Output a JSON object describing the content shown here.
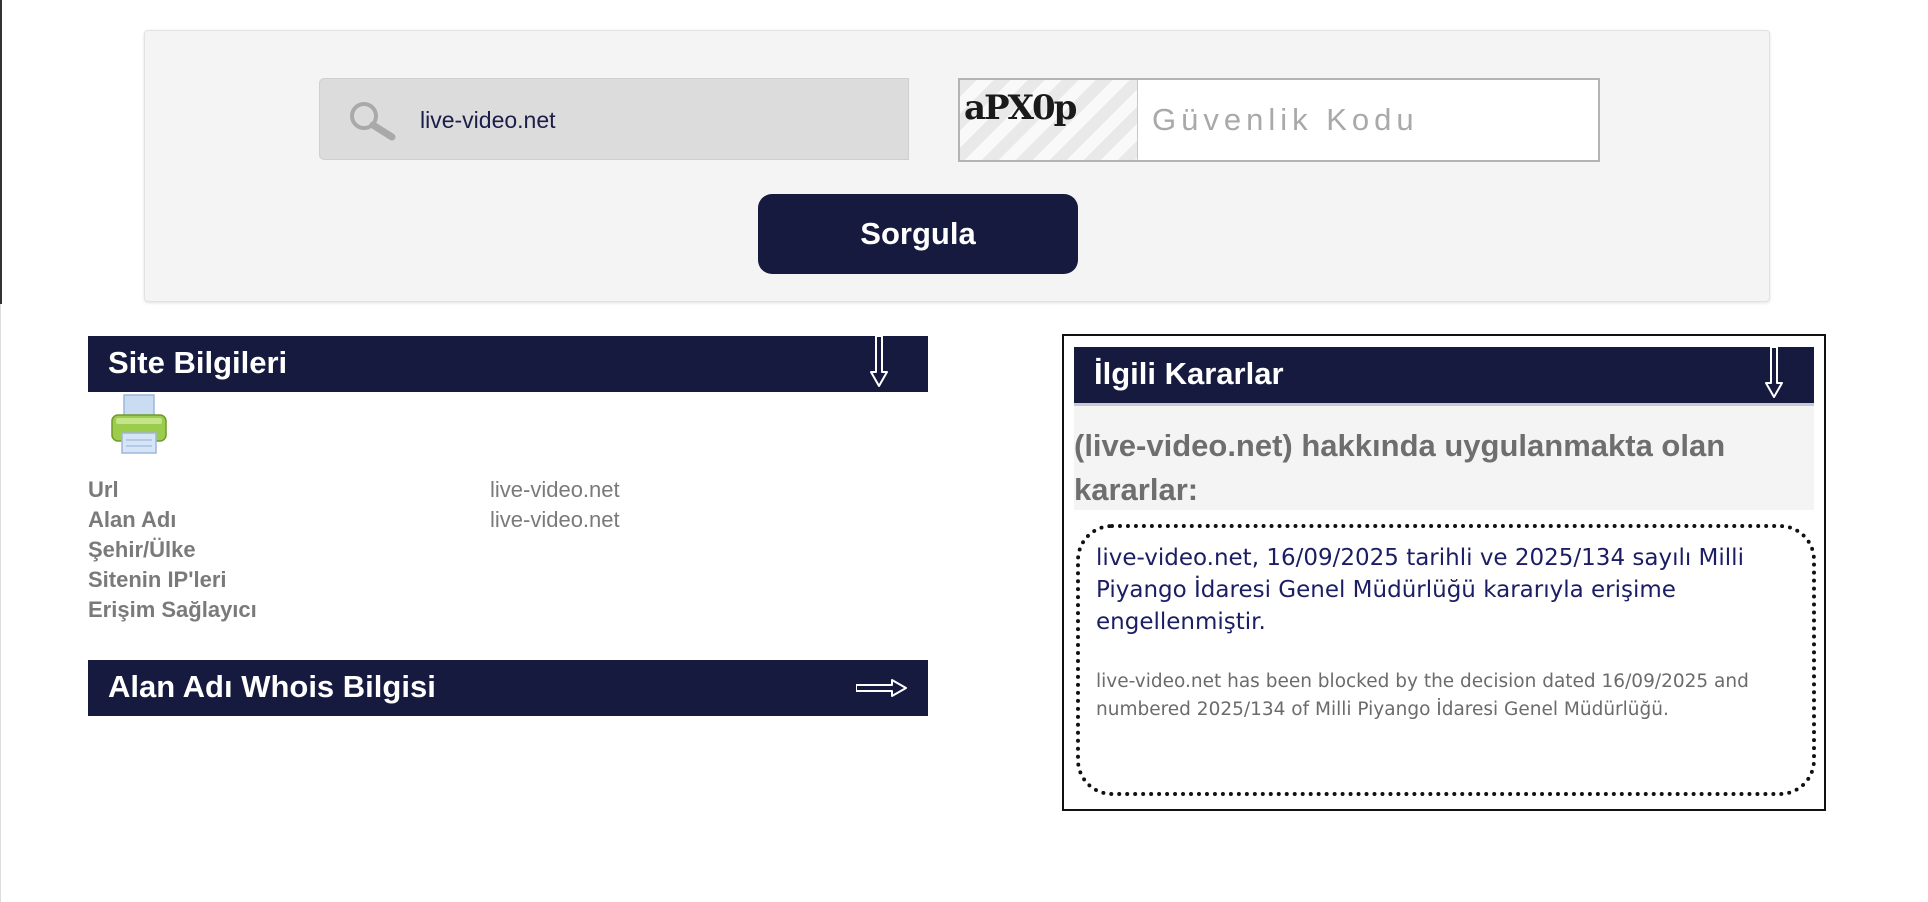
{
  "search": {
    "url_value": "live-video.net",
    "captcha_image_text": "aPX0p",
    "captcha_placeholder": "Güvenlik Kodu",
    "submit_label": "Sorgula"
  },
  "site_info": {
    "title": "Site Bilgileri",
    "rows": [
      {
        "label": "Url",
        "value": "live-video.net"
      },
      {
        "label": "Alan Adı",
        "value": "live-video.net"
      },
      {
        "label": "Şehir/Ülke",
        "value": ""
      },
      {
        "label": "Sitenin IP'leri",
        "value": ""
      },
      {
        "label": "Erişim Sağlayıcı",
        "value": ""
      }
    ]
  },
  "whois": {
    "title": "Alan Adı Whois Bilgisi"
  },
  "decisions": {
    "title": "İlgili Kararlar",
    "intro": "(live-video.net) hakkında uygulanmakta olan kararlar:",
    "decision_tr": "live-video.net, 16/09/2025 tarihli ve 2025/134 sayılı Milli Piyango İdaresi Genel Müdürlüğü kararıyla erişime engellenmiştir.",
    "decision_en": "live-video.net has been blocked by the decision dated 16/09/2025 and numbered 2025/134 of Milli Piyango İdaresi Genel Müdürlüğü."
  },
  "colors": {
    "header_navy": "#161a3e",
    "panel_gray": "#f4f4f4",
    "label_gray": "#7a7a7a",
    "decision_text_navy": "#1b1e62"
  },
  "icons": {
    "search": "magnifier-icon",
    "print": "printer-icon",
    "expand": "arrow-down-icon",
    "open": "arrow-right-icon"
  }
}
